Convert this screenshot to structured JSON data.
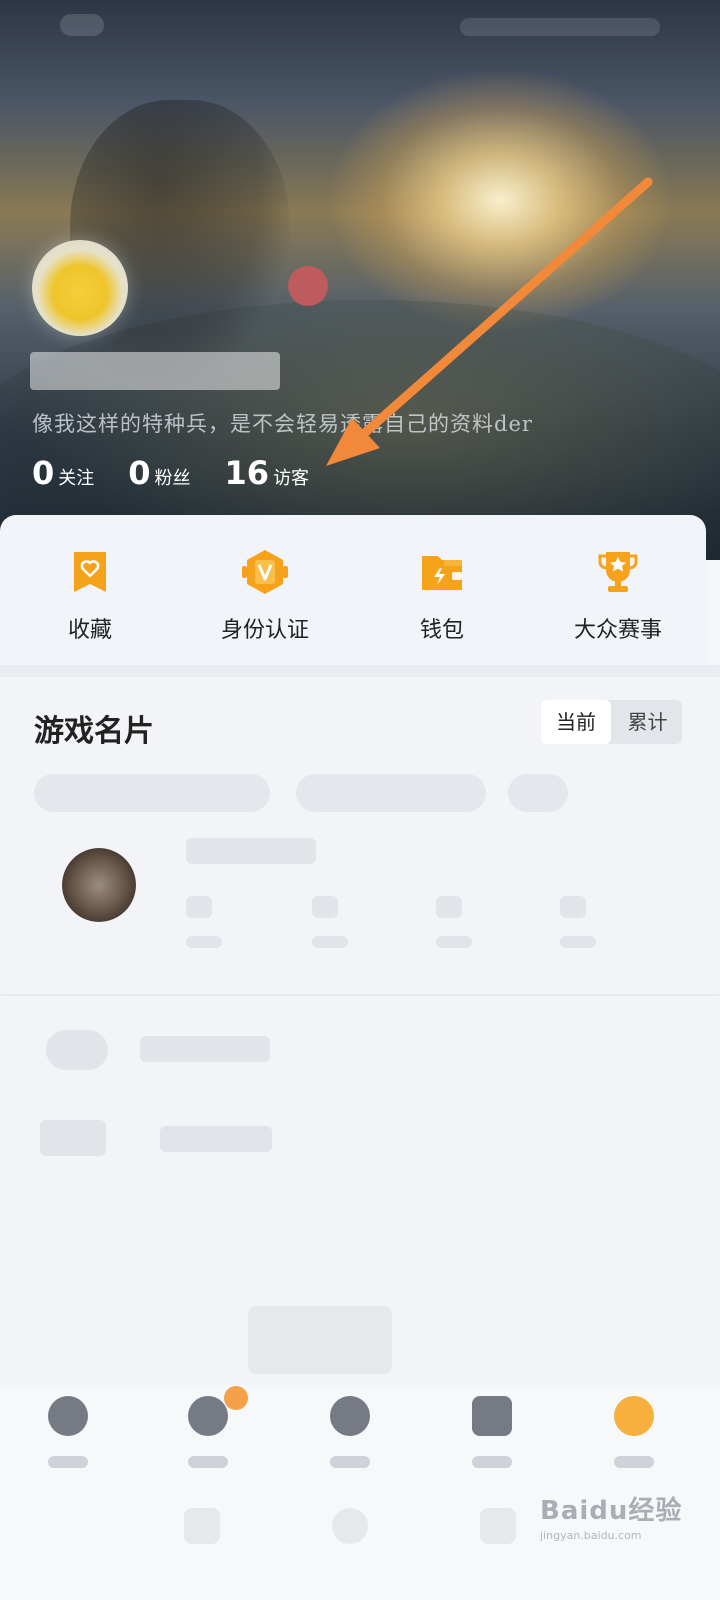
{
  "profile": {
    "bio": "像我这样的特种兵，是不会轻易透露自己的资料der",
    "stats": [
      {
        "value": "0",
        "label": "关注"
      },
      {
        "value": "0",
        "label": "粉丝"
      },
      {
        "value": "16",
        "label": "访客"
      }
    ]
  },
  "quick_actions": [
    {
      "label": "收藏",
      "icon": "bookmark-heart-icon"
    },
    {
      "label": "身份认证",
      "icon": "verified-v-icon"
    },
    {
      "label": "钱包",
      "icon": "wallet-icon"
    },
    {
      "label": "大众赛事",
      "icon": "trophy-icon"
    }
  ],
  "game_card": {
    "title": "游戏名片",
    "toggle": {
      "current": "当前",
      "cumulative": "累计"
    }
  },
  "colors": {
    "accent_orange": "#f7a21b",
    "annotation_arrow": "#f2883a"
  },
  "watermark": {
    "brand": "Baidu经验",
    "url": "jingyan.baidu.com"
  }
}
